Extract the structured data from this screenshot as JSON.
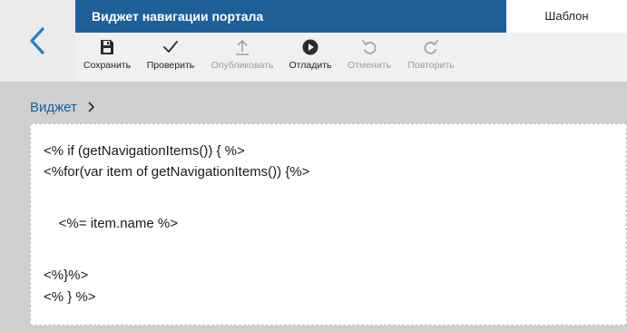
{
  "window": {
    "title": "Виджет навигации портала",
    "active_tab": "Шаблон"
  },
  "navigation": {
    "back_icon": "chevron-left-icon"
  },
  "toolbar": {
    "items": [
      {
        "label": "Сохранить",
        "icon": "save-icon",
        "enabled": true
      },
      {
        "label": "Проверить",
        "icon": "check-icon",
        "enabled": true
      },
      {
        "label": "Опубликовать",
        "icon": "upload-icon",
        "enabled": false
      },
      {
        "label": "Отладить",
        "icon": "play-icon",
        "enabled": true
      },
      {
        "label": "Отменить",
        "icon": "undo-icon",
        "enabled": false
      },
      {
        "label": "Повторить",
        "icon": "redo-icon",
        "enabled": false
      }
    ]
  },
  "breadcrumb": {
    "item": "Виджет"
  },
  "editor": {
    "lines": [
      "<% if (getNavigationItems()) { %>",
      "<%for(var item of getNavigationItems()) {%>",
      "    <%= item.name %>",
      "<%}%>",
      "<% } %>"
    ]
  },
  "colors": {
    "accent": "#1f5f97",
    "toolbar_bg": "#f0f0f0",
    "page_bg": "#cfcfcf",
    "disabled_text": "#9b9b9b"
  }
}
